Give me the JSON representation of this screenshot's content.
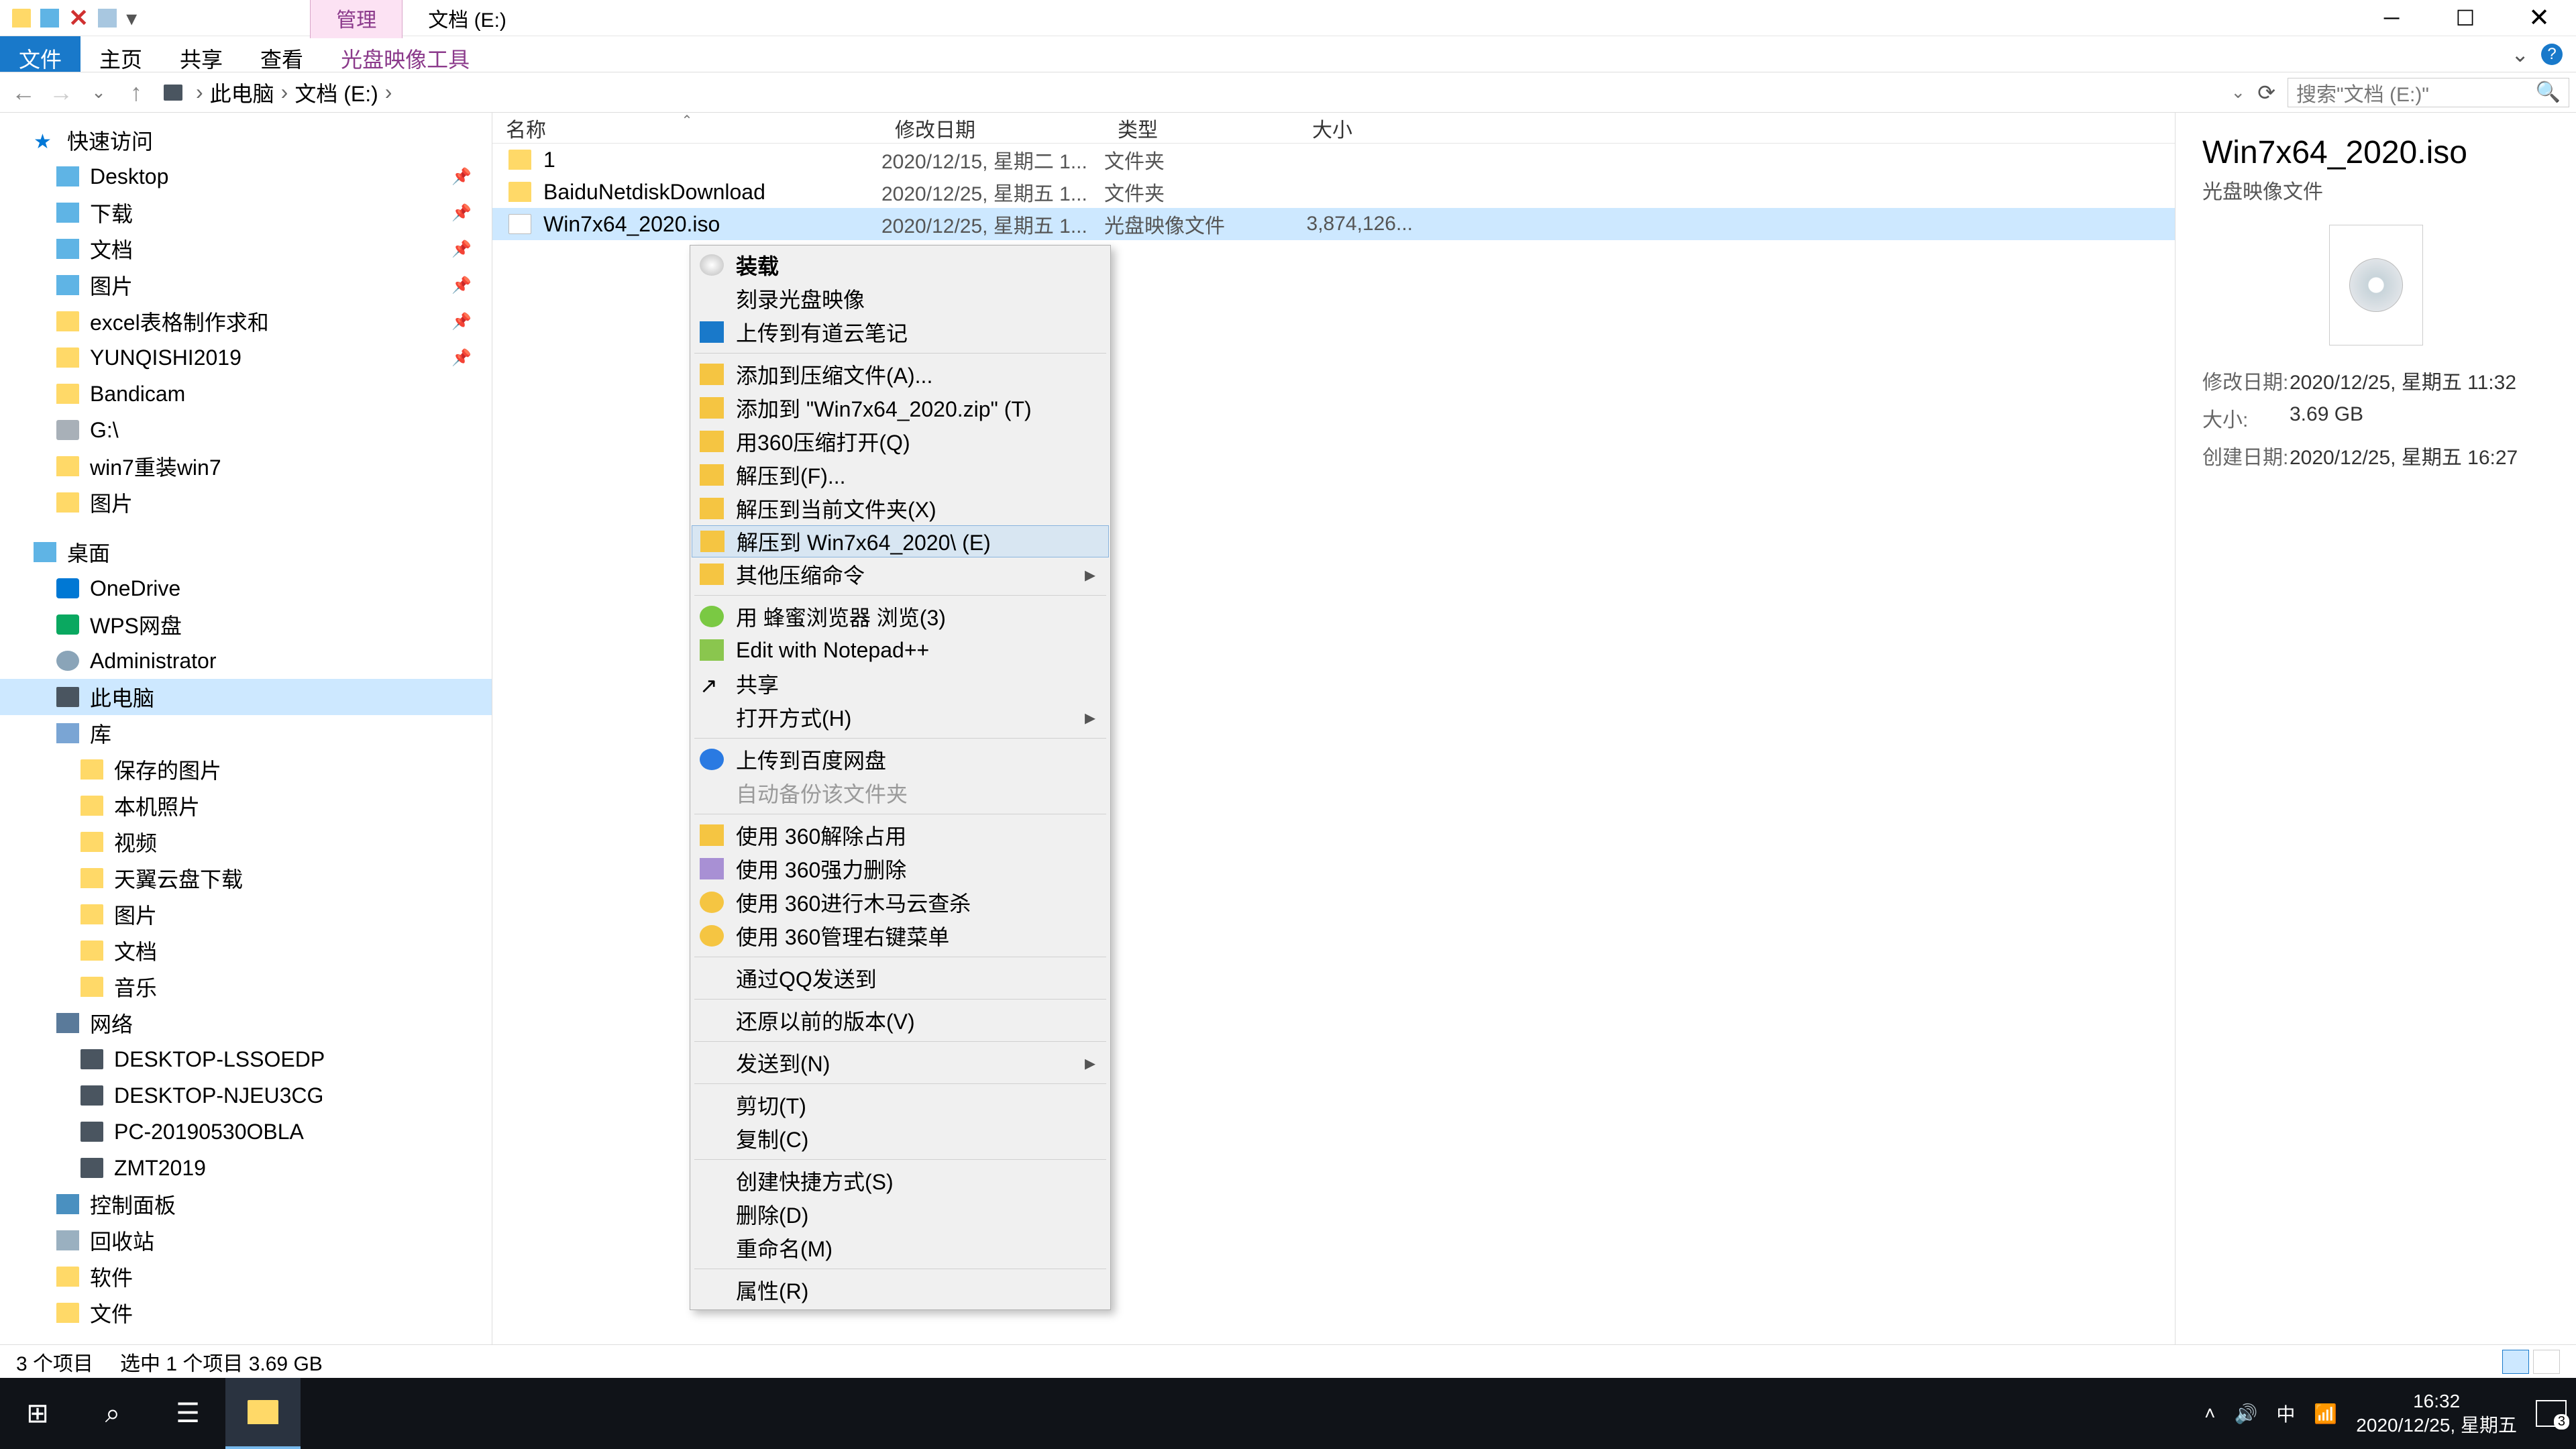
{
  "title": {
    "manage_tab": "管理",
    "drive_label": "文档 (E:)"
  },
  "ribbon": {
    "file": "文件",
    "home": "主页",
    "share": "共享",
    "view": "查看",
    "isotools": "光盘映像工具"
  },
  "address": {
    "this_pc": "此电脑",
    "drive": "文档 (E:)",
    "search_placeholder": "搜索\"文档 (E:)\""
  },
  "columns": {
    "name": "名称",
    "date": "修改日期",
    "type": "类型",
    "size": "大小"
  },
  "files": [
    {
      "name": "1",
      "date": "2020/12/15, 星期二 1...",
      "type": "文件夹",
      "size": ""
    },
    {
      "name": "BaiduNetdiskDownload",
      "date": "2020/12/25, 星期五 1...",
      "type": "文件夹",
      "size": ""
    },
    {
      "name": "Win7x64_2020.iso",
      "date": "2020/12/25, 星期五 1...",
      "type": "光盘映像文件",
      "size": "3,874,126..."
    }
  ],
  "sidebar": {
    "quick": "快速访问",
    "items_quick": [
      "Desktop",
      "下载",
      "文档",
      "图片",
      "excel表格制作求和",
      "YUNQISHI2019",
      "Bandicam",
      "G:\\",
      "win7重装win7",
      "图片"
    ],
    "desktop": "桌面",
    "items_desktop": [
      "OneDrive",
      "WPS网盘",
      "Administrator",
      "此电脑",
      "库"
    ],
    "items_lib": [
      "保存的图片",
      "本机照片",
      "视频",
      "天翼云盘下载",
      "图片",
      "文档",
      "音乐"
    ],
    "network": "网络",
    "items_net": [
      "DESKTOP-LSSOEDP",
      "DESKTOP-NJEU3CG",
      "PC-20190530OBLA",
      "ZMT2019"
    ],
    "items_tail": [
      "控制面板",
      "回收站",
      "软件",
      "文件"
    ]
  },
  "ctx": {
    "mount": "装载",
    "burn": "刻录光盘映像",
    "youdao": "上传到有道云笔记",
    "addarchive": "添加到压缩文件(A)...",
    "addzip": "添加到 \"Win7x64_2020.zip\" (T)",
    "open360": "用360压缩打开(Q)",
    "extract_to": "解压到(F)...",
    "extract_here": "解压到当前文件夹(X)",
    "extract_named": "解压到 Win7x64_2020\\ (E)",
    "other_compress": "其他压缩命令",
    "honeybrowser": "用 蜂蜜浏览器 浏览(3)",
    "npp": "Edit with Notepad++",
    "share": "共享",
    "openwith": "打开方式(H)",
    "upload_baidu": "上传到百度网盘",
    "autobackup": "自动备份该文件夹",
    "unlock360": "使用 360解除占用",
    "force360": "使用 360强力删除",
    "trojan360": "使用 360进行木马云查杀",
    "menu360": "使用 360管理右键菜单",
    "sendqq": "通过QQ发送到",
    "restore": "还原以前的版本(V)",
    "sendto": "发送到(N)",
    "cut": "剪切(T)",
    "copy": "复制(C)",
    "shortcut": "创建快捷方式(S)",
    "delete": "删除(D)",
    "rename": "重命名(M)",
    "props": "属性(R)"
  },
  "details": {
    "title": "Win7x64_2020.iso",
    "type": "光盘映像文件",
    "mod_label": "修改日期:",
    "mod": "2020/12/25, 星期五 11:32",
    "size_label": "大小:",
    "size": "3.69 GB",
    "create_label": "创建日期:",
    "create": "2020/12/25, 星期五 16:27"
  },
  "status": {
    "count": "3 个项目",
    "sel": "选中 1 个项目  3.69 GB"
  },
  "taskbar": {
    "ime": "中",
    "time": "16:32",
    "date": "2020/12/25, 星期五",
    "badge": "3"
  }
}
